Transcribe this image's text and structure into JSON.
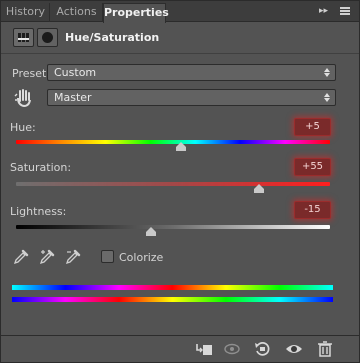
{
  "tabs": [
    {
      "label": "History"
    },
    {
      "label": "Actions"
    },
    {
      "label": "Properties"
    }
  ],
  "header": {
    "title": "Hue/Saturation",
    "adjustment_icon": "hue-saturation-adjustment-icon",
    "mask_icon": "layer-mask-icon"
  },
  "preset": {
    "label": "Preset:",
    "value": "Custom"
  },
  "channel": {
    "value": "Master",
    "tool_icon": "targeted-adjustment-hand-icon"
  },
  "sliders": {
    "hue": {
      "label": "Hue:",
      "value": "+5",
      "position": 0.53
    },
    "saturation": {
      "label": "Saturation:",
      "value": "+55",
      "position": 0.78
    },
    "lightness": {
      "label": "Lightness:",
      "value": "-15",
      "position": 0.43
    }
  },
  "colorize": {
    "label": "Colorize",
    "checked": false
  },
  "colors": {
    "value_highlight": "#7a2a2a",
    "panel_bg": "#535353"
  },
  "toolbar_icons": [
    "clip-to-layer-icon",
    "view-previous-state-icon",
    "reset-icon",
    "visibility-eye-icon",
    "trash-icon"
  ]
}
